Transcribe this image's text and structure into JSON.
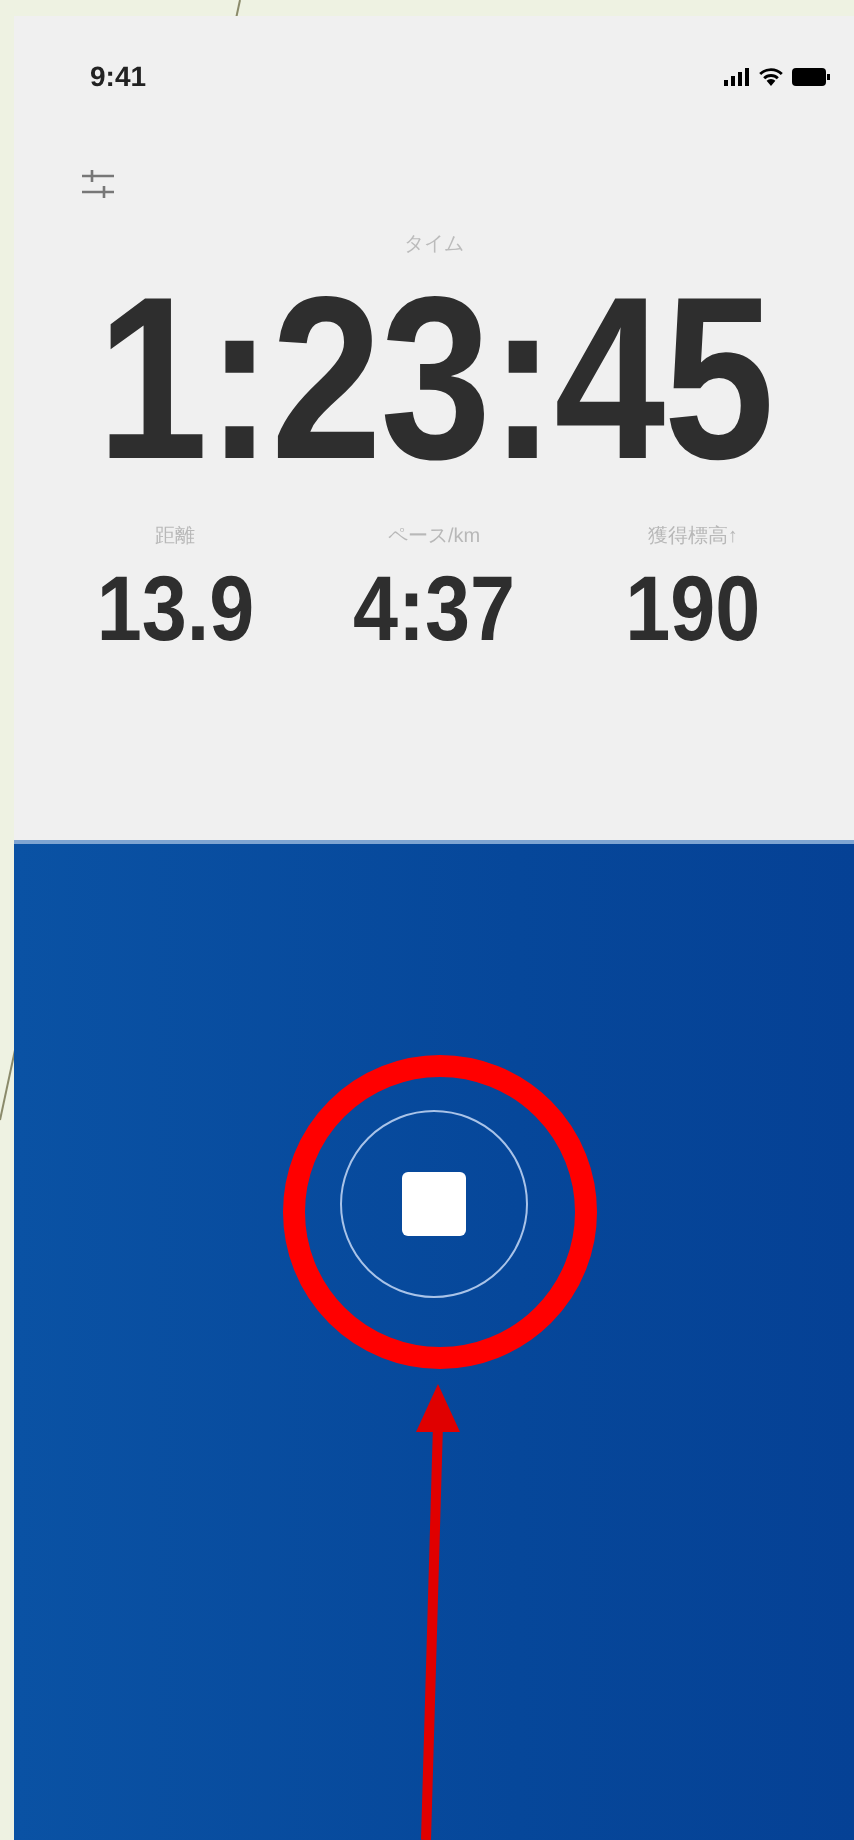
{
  "status_bar": {
    "time": "9:41"
  },
  "main_metric": {
    "label": "タイム",
    "value": "1:23:45"
  },
  "stats": [
    {
      "label": "距離",
      "value": "13.9"
    },
    {
      "label": "ペース/km",
      "value": "4:37"
    },
    {
      "label": "獲得標高↑",
      "value": "190"
    }
  ]
}
